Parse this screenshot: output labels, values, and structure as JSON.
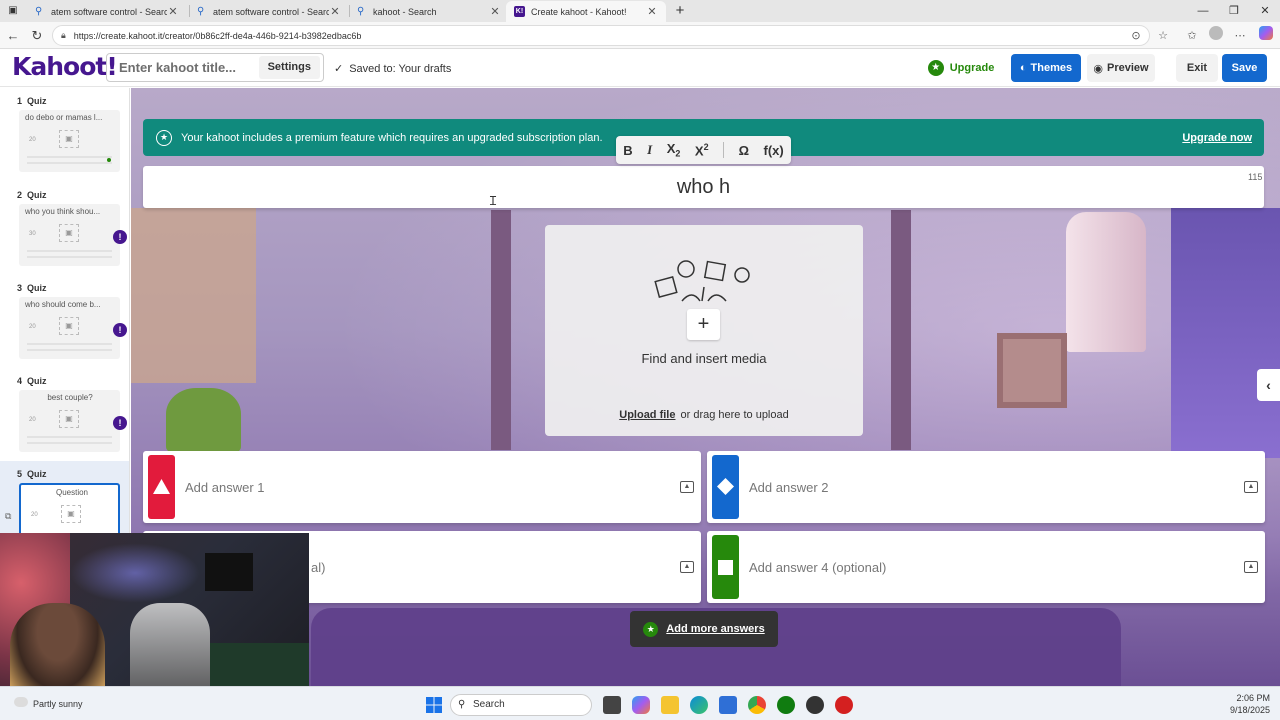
{
  "browser": {
    "tabs": [
      {
        "label": "atem software control - Search",
        "icon": "search-icon",
        "active": false
      },
      {
        "label": "atem software control - Search",
        "icon": "search-icon",
        "active": false
      },
      {
        "label": "kahoot - Search",
        "icon": "search-icon",
        "active": false
      },
      {
        "label": "Create kahoot - Kahoot!",
        "icon": "kahoot-icon",
        "active": true
      }
    ],
    "new_tab": "+",
    "url": "https://create.kahoot.it/creator/0b86c2ff-de4a-446b-9214-b3982edbac6b"
  },
  "header": {
    "logo": "Kahoot!",
    "title_placeholder": "Enter kahoot title...",
    "settings_label": "Settings",
    "saved_status": "Saved to: Your drafts",
    "upgrade_label": "Upgrade",
    "themes_label": "Themes",
    "preview_label": "Preview",
    "exit_label": "Exit",
    "save_label": "Save"
  },
  "sidebar": {
    "slides": [
      {
        "number": "1",
        "type": "Quiz",
        "text": "do debo or mamas l...",
        "time": "20",
        "warning": false
      },
      {
        "number": "2",
        "type": "Quiz",
        "text": "who you think shou...",
        "time": "30",
        "warning": true
      },
      {
        "number": "3",
        "type": "Quiz",
        "text": "who should come b...",
        "time": "20",
        "warning": true
      },
      {
        "number": "4",
        "type": "Quiz",
        "text": "best couple?",
        "time": "20",
        "warning": true
      },
      {
        "number": "5",
        "type": "Quiz",
        "text": "Question",
        "time": "20",
        "warning": false
      }
    ]
  },
  "editor": {
    "premium_notice": "Your kahoot includes a premium feature which requires an upgraded subscription plan.",
    "premium_link": "Upgrade now",
    "format_buttons": {
      "bold": "B",
      "italic": "I",
      "subscript": "X",
      "subscript_mark": "2",
      "superscript": "X",
      "superscript_mark": "2",
      "symbol": "Ω",
      "function": "f(x)"
    },
    "question_text": "who h",
    "char_count": "115",
    "media": {
      "find_label": "Find and insert media",
      "upload_label": "Upload file",
      "drag_label": "or drag here to upload"
    },
    "answers": [
      {
        "label": "Add answer 1",
        "color": "#e21b3c",
        "shape": "triangle"
      },
      {
        "label": "Add answer 2",
        "color": "#1368ce",
        "shape": "diamond"
      },
      {
        "label": "al)",
        "color": "#d89e00",
        "shape": "circle"
      },
      {
        "label": "Add answer 4 (optional)",
        "color": "#26890c",
        "shape": "square"
      }
    ],
    "add_more_label": "Add more answers"
  },
  "taskbar": {
    "weather": "Partly sunny",
    "search_label": "Search",
    "time": "2:06 PM",
    "date": "9/18/2025"
  },
  "colors": {
    "kahoot_purple": "#46178f",
    "blue": "#1368ce",
    "green": "#26890c",
    "teal": "#108a7d"
  }
}
